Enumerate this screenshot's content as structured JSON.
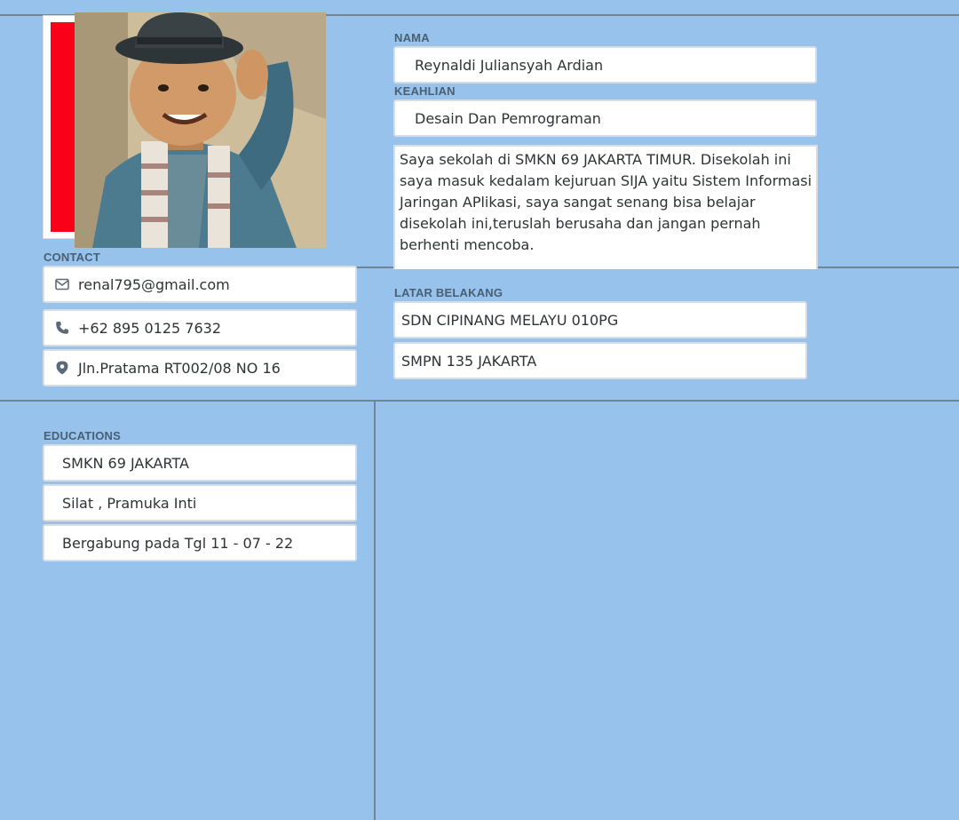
{
  "profile": {
    "photo_alt": "profile photo"
  },
  "identity": {
    "name_label": "NAMA",
    "name_value": "Reynaldi Juliansyah Ardian",
    "skill_label": "KEAHLIAN",
    "skill_value": "Desain Dan Pemrograman",
    "about": "Saya sekolah di SMKN 69 JAKARTA TIMUR. Disekolah ini saya masuk kedalam kejuruan SIJA yaitu Sistem Informasi Jaringan APlikasi, saya sangat senang bisa belajar disekolah ini,teruslah berusaha dan jangan pernah berhenti mencoba."
  },
  "contact": {
    "label": "CONTACT",
    "email": "renal795@gmail.com",
    "phone": "+62 895 0125 7632",
    "address": "Jln.Pratama RT002/08 NO 16"
  },
  "background": {
    "label": "LATAR BELAKANG",
    "items": [
      "SDN CIPINANG MELAYU 010PG",
      "SMPN 135 JAKARTA"
    ]
  },
  "educations": {
    "label": "EDUCATIONS",
    "items": [
      "SMKN 69 JAKARTA",
      "Silat , Pramuka Inti",
      "Bergabung pada Tgl 11 - 07 - 22"
    ]
  },
  "colors": {
    "background": "#97c2eb",
    "accent_red": "#fb0019",
    "divider": "#6f8699",
    "label": "#4a5f73"
  },
  "icons": {
    "email": "mail-icon",
    "phone": "phone-icon",
    "address": "location-pin-icon"
  }
}
